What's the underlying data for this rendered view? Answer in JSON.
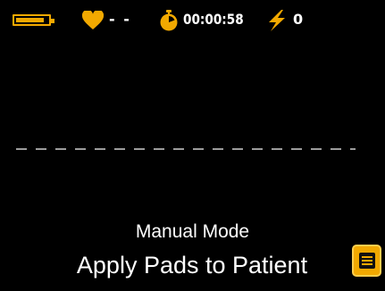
{
  "status_bar": {
    "battery_level": 0.9,
    "heart_rate": "- -",
    "elapsed_time": "00:00:58",
    "shock_count": "0"
  },
  "icons": {
    "battery": "battery-icon",
    "heart": "heart-icon",
    "timer": "stopwatch-icon",
    "shock": "lightning-bolt-icon",
    "menu": "menu-list-icon"
  },
  "messages": {
    "mode": "Manual Mode",
    "prompt": "Apply Pads to Patient"
  },
  "colors": {
    "accent": "#f2a900",
    "background": "#000000",
    "text": "#ffffff"
  }
}
